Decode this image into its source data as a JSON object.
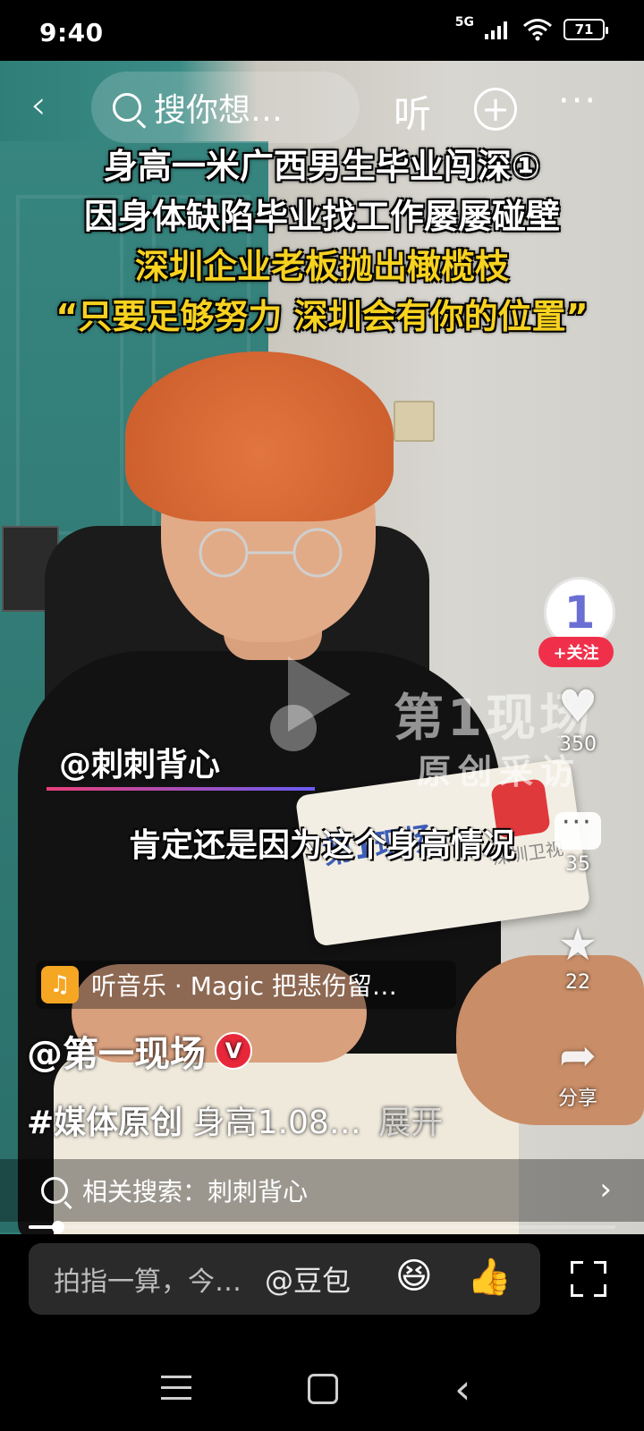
{
  "status_bar": {
    "time": "9:40",
    "network": "5G",
    "battery": "71"
  },
  "top_nav": {
    "search_placeholder": "搜你想…",
    "listen_label": "听"
  },
  "headline": {
    "line1": "身高一米广西男生毕业闯深①",
    "line2": "因身体缺陷毕业找工作屡屡碰壁",
    "line3": "深圳企业老板抛出橄榄枝",
    "line4": "“只要足够努力 深圳会有你的位置”"
  },
  "video_overlay": {
    "mention": "@刺刺背心",
    "subtitle": "肯定还是因为这个身高情况",
    "watermark_line1": "第1现场",
    "watermark_line2": "原创采访",
    "mic_flag_text": "第1现场",
    "mic_flag_channel": "深圳卫视"
  },
  "rail": {
    "avatar_text": "1",
    "follow_label": "+关注",
    "like_count": "350",
    "comment_count": "35",
    "favorite_count": "22",
    "share_label": "分享"
  },
  "info": {
    "music": "听音乐 · Magic 把悲伤留…",
    "author": "@第一现场",
    "verified_badge": "V",
    "description_tag": "#媒体原创",
    "description_text": "身高1.08…",
    "expand_label": "展开",
    "related_search": "相关搜索：刺刺背心"
  },
  "playback": {
    "progress": 0.05
  },
  "comment_input": {
    "placeholder": "拍指一算，今…",
    "at_label": "@豆包"
  },
  "icons": [
    "back-arrow-icon",
    "search-icon",
    "plus-circle-icon",
    "more-dots-icon",
    "heart-icon",
    "comment-icon",
    "star-icon",
    "share-icon",
    "music-headphones-icon",
    "fullscreen-icon",
    "menu-icon",
    "home-icon",
    "back-icon",
    "play-icon"
  ]
}
